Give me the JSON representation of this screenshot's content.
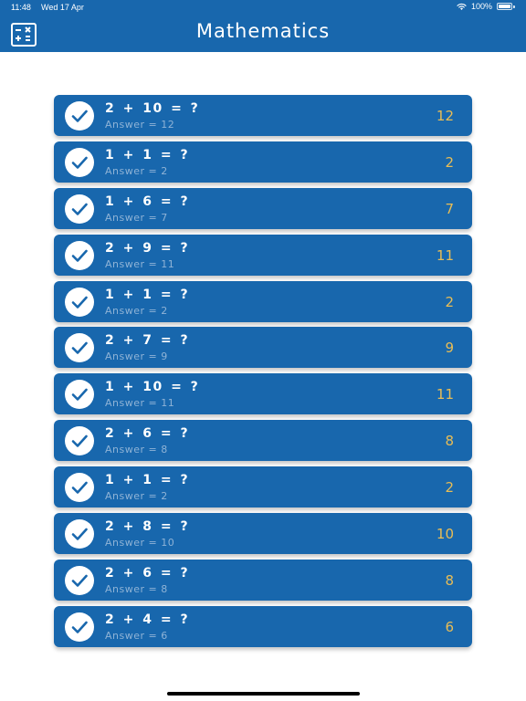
{
  "status_bar": {
    "time": "11:48",
    "date": "Wed 17 Apr",
    "battery": "100%",
    "icons": [
      "wifi-icon",
      "battery-icon"
    ]
  },
  "header": {
    "title": "Mathematics",
    "calculator_icon": "calculator-icon",
    "background_color": "#1867ad"
  },
  "colors": {
    "row_background": "#1867ad",
    "answer_value": "#e9bd55",
    "answer_line": "#8fb3d6",
    "check_color": "#1867ad"
  },
  "questions": [
    {
      "question": "2 + 10 = ?",
      "answer_line": "Answer = 12",
      "answer": "12"
    },
    {
      "question": "1 + 1 = ?",
      "answer_line": "Answer = 2",
      "answer": "2"
    },
    {
      "question": "1 + 6 = ?",
      "answer_line": "Answer = 7",
      "answer": "7"
    },
    {
      "question": "2 + 9 = ?",
      "answer_line": "Answer = 11",
      "answer": "11"
    },
    {
      "question": "1 + 1 = ?",
      "answer_line": "Answer = 2",
      "answer": "2"
    },
    {
      "question": "2 + 7 = ?",
      "answer_line": "Answer = 9",
      "answer": "9"
    },
    {
      "question": "1 + 10 = ?",
      "answer_line": "Answer = 11",
      "answer": "11"
    },
    {
      "question": "2 + 6 = ?",
      "answer_line": "Answer = 8",
      "answer": "8"
    },
    {
      "question": "1 + 1 = ?",
      "answer_line": "Answer = 2",
      "answer": "2"
    },
    {
      "question": "2 + 8 = ?",
      "answer_line": "Answer = 10",
      "answer": "10"
    },
    {
      "question": "2 + 6 = ?",
      "answer_line": "Answer = 8",
      "answer": "8"
    },
    {
      "question": "2 + 4 = ?",
      "answer_line": "Answer = 6",
      "answer": "6"
    }
  ]
}
